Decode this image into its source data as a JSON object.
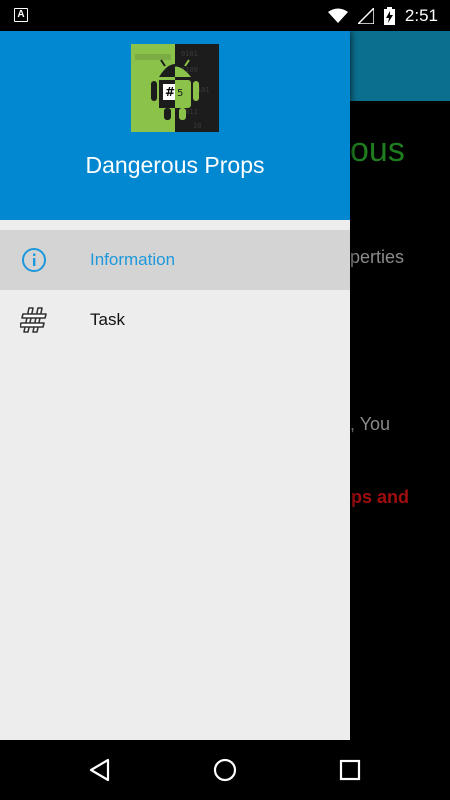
{
  "status_bar": {
    "time": "2:51",
    "notification_icon": "accessibility-a-icon",
    "notification_glyph": "A"
  },
  "app_background": {
    "title_fragment": "ous",
    "line1_fragment": "operties",
    "line2_fragment": "e, You",
    "line3_fragment": "ops and"
  },
  "drawer": {
    "title": "Dangerous Props",
    "logo_badge": "#5",
    "items": [
      {
        "label": "Information",
        "icon": "info-icon",
        "active": true
      },
      {
        "label": "Task",
        "icon": "hash-icon",
        "active": false
      }
    ]
  },
  "colors": {
    "header": "#0288d1",
    "active_text": "#1e98dc",
    "active_bg": "#d4d4d4",
    "drawer_bg": "#ededed"
  }
}
